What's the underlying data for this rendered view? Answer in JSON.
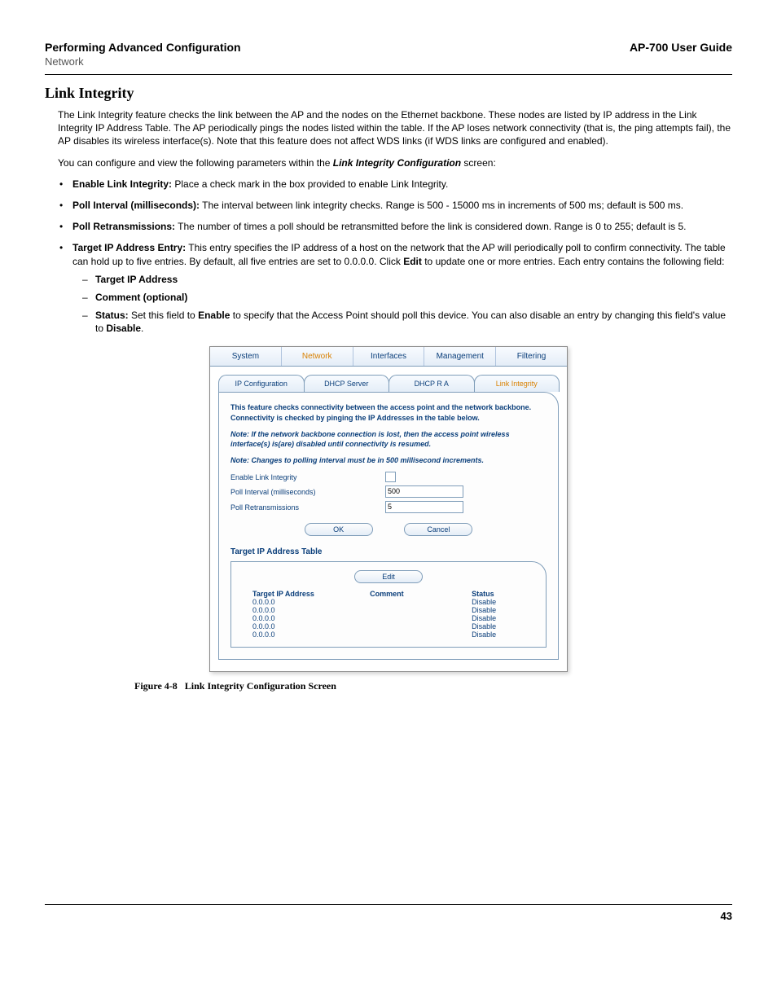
{
  "header": {
    "left": "Performing Advanced Configuration",
    "right": "AP-700 User Guide",
    "sub": "Network"
  },
  "section_title": "Link Integrity",
  "intro": "The Link Integrity feature checks the link between the AP and the nodes on the Ethernet backbone. These nodes are listed by IP address in the Link Integrity IP Address Table. The AP periodically pings the nodes listed within the table. If the AP loses network connectivity (that is, the ping attempts fail), the AP disables its wireless interface(s). Note that this feature does not affect WDS links (if WDS links are configured and enabled).",
  "config_intro_pre": "You can configure and view the following parameters within the ",
  "config_intro_em": "Link Integrity Configuration",
  "config_intro_post": " screen:",
  "bullets": {
    "b1_label": "Enable Link Integrity:",
    "b1_text": " Place a check mark in the box provided to enable Link Integrity.",
    "b2_label": "Poll Interval (milliseconds):",
    "b2_text": " The interval between link integrity checks. Range is 500 - 15000 ms in increments of 500 ms; default is 500 ms.",
    "b3_label": "Poll Retransmissions:",
    "b3_text": " The number of times a poll should be retransmitted before the link is considered down. Range is 0 to 255; default is 5.",
    "b4_label": "Target IP Address Entry:",
    "b4_text_a": " This entry specifies the IP address of a host on the network that the AP will periodically poll to confirm connectivity. The table can hold up to five entries. By default, all five entries are set to 0.0.0.0. Click ",
    "b4_edit": "Edit",
    "b4_text_b": " to update one or more entries. Each entry contains the following field:",
    "s1": "Target IP Address",
    "s2": "Comment (optional)",
    "s3_label": "Status:",
    "s3_a": " Set this field to ",
    "s3_en": "Enable",
    "s3_b": " to specify that the Access Point should poll this device. You can also disable an entry by changing this field's value to ",
    "s3_dis": "Disable",
    "s3_c": "."
  },
  "ui": {
    "top_tabs": {
      "t1": "System",
      "t2": "Network",
      "t3": "Interfaces",
      "t4": "Management",
      "t5": "Filtering"
    },
    "sub_tabs": {
      "s1": "IP Configuration",
      "s2": "DHCP Server",
      "s3": "DHCP R A",
      "s4": "Link Integrity"
    },
    "desc1": "This feature checks connectivity between the access point and the network backbone. Connectivity is checked by pinging the IP Addresses in the table below.",
    "desc2": "Note: If the network backbone connection is lost, then the access point wireless interface(s) is(are) disabled until connectivity is resumed.",
    "desc3": "Note: Changes to polling interval must be in 500 millisecond increments.",
    "row1": "Enable Link Integrity",
    "row2": "Poll Interval (milliseconds)",
    "row2_val": "500",
    "row3": "Poll Retransmissions",
    "row3_val": "5",
    "ok": "OK",
    "cancel": "Cancel",
    "tbl_title": "Target IP Address Table",
    "edit": "Edit",
    "h1": "Target IP Address",
    "h2": "Comment",
    "h3": "Status",
    "ip": "0.0.0.0",
    "st": "Disable"
  },
  "caption": {
    "fig": "Figure 4-8",
    "text": "Link Integrity Configuration Screen"
  },
  "page": "43"
}
